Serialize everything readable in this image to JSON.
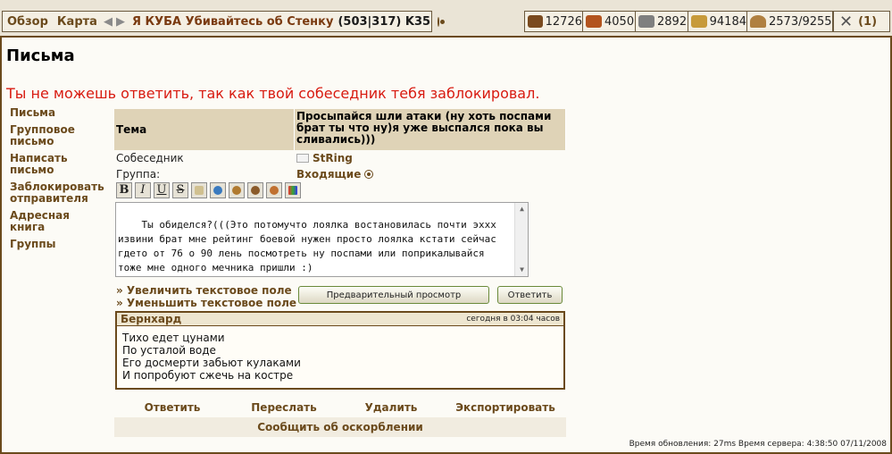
{
  "nav": {
    "overview": "Обзор",
    "map": "Карта",
    "prev_arrow": "◀",
    "next_arrow": "▶",
    "village_name": "Я КУБА Убивайтесь об Стенку",
    "coords": "(503|317) K35"
  },
  "resources": {
    "wood": "12726",
    "clay": "4050",
    "iron": "2892",
    "crop": "94184",
    "population": "2573/9255",
    "attacks": "(1)"
  },
  "page": {
    "title": "Письма",
    "error": "Ты не можешь ответить, так как твой собеседник тебя заблокировал."
  },
  "sidebar": {
    "items": [
      {
        "label": "Письма"
      },
      {
        "label": "Групповое письмо"
      },
      {
        "label": "Написать письмо"
      },
      {
        "label": "Заблокировать отправителя"
      },
      {
        "label": "Адресная книга"
      },
      {
        "label": "Группы"
      }
    ]
  },
  "message": {
    "subject_label": "Тема",
    "subject": "Просыпайся шли атаки (ну хоть поспами брат ты что ну)я уже выспался пока вы сливались)))",
    "partner_label": "Собеседник",
    "partner": "StRing",
    "group_label": "Группа:",
    "group": "Входящие",
    "reply_text": "Ты обиделся?(((Это потомучто лоялка востановилась почти эххх извини брат мне рейтинг боевой нужен просто лоялка кстати сейчас гдето от 76 о 90 лень посмотреть ну поспами или поприкалывайся тоже мне одного мечника пришли :)",
    "enlarge": "» Увеличить текстовое поле",
    "shrink": "» Уменьшить текстовое поле",
    "preview_button": "Предварительный просмотр",
    "reply_button": "Ответить"
  },
  "quoted": {
    "author": "Бернхард",
    "time": "сегодня в 03:04 часов",
    "lines": [
      "Тихо едет цунами",
      "По усталой воде",
      "Его досмерти забьют кулаками",
      "И попробуют сжечь на костре"
    ]
  },
  "actions": {
    "reply": "Ответить",
    "forward": "Переслать",
    "delete": "Удалить",
    "export": "Экспортировать",
    "report": "Сообщить об оскорблении"
  },
  "footer": {
    "text": "Время обновления: 27ms Время сервера: 4:38:50 07/11/2008"
  },
  "toolbar": {
    "bold": "B",
    "italic": "I",
    "underline": "U",
    "strike": "S"
  }
}
